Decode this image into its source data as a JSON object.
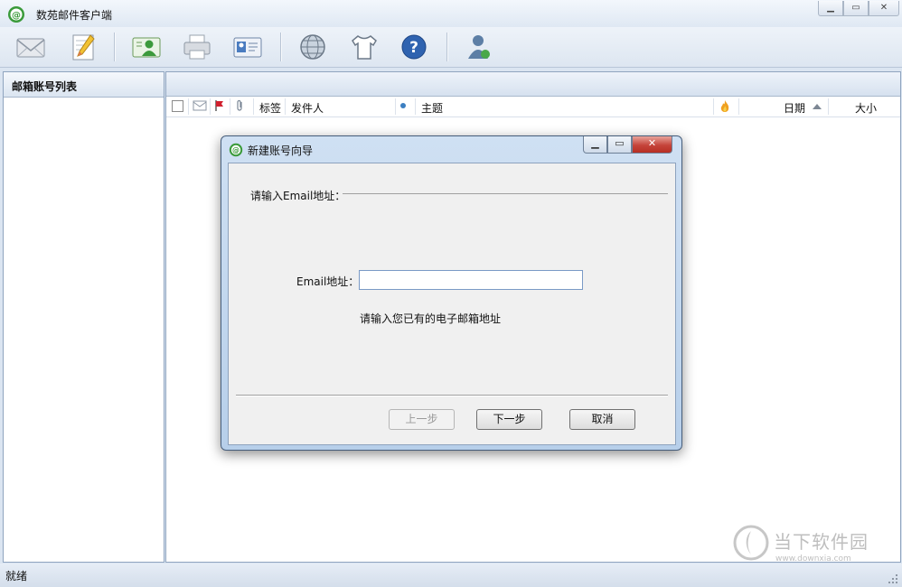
{
  "app": {
    "title": "数苑邮件客户端"
  },
  "toolbar": {
    "buttons": [
      {
        "icon": "receive-mail-icon"
      },
      {
        "icon": "compose-icon"
      },
      {
        "icon": "contacts-icon"
      },
      {
        "icon": "print-icon"
      },
      {
        "icon": "address-card-icon"
      },
      {
        "icon": "globe-icon"
      },
      {
        "icon": "skin-icon"
      },
      {
        "icon": "help-icon"
      },
      {
        "icon": "user-account-icon"
      }
    ]
  },
  "left_panel": {
    "header": "邮箱账号列表"
  },
  "mail_list": {
    "columns": {
      "tag": "标签",
      "sender": "发件人",
      "subject": "主题",
      "date": "日期",
      "size": "大小"
    },
    "sort_column": "日期",
    "sort_direction": "ascending"
  },
  "status": {
    "text": "就绪"
  },
  "dialog": {
    "title": "新建账号向导",
    "step_heading": "请输入Email地址：",
    "email_label": "Email地址：",
    "email_value": "",
    "email_placeholder": "",
    "hint": "请输入您已有的电子邮箱地址",
    "buttons": {
      "prev": "上一步",
      "next": "下一步",
      "cancel": "取消"
    },
    "prev_enabled": false
  },
  "watermark": {
    "name": "当下软件园",
    "url": "www.downxia.com"
  },
  "colors": {
    "accent": "#3c7fc1",
    "flag": "#d0202e",
    "close_button": "#c5443a",
    "app_logo": "#3a9a3a"
  }
}
